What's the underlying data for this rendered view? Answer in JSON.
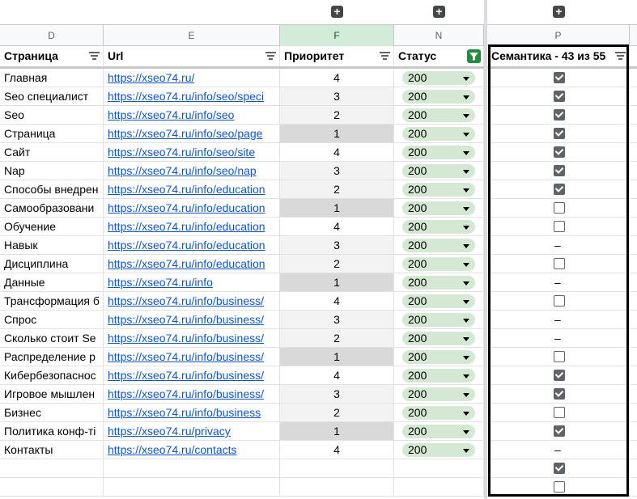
{
  "columns": {
    "D": "D",
    "E": "E",
    "F": "F",
    "N": "N",
    "P": "P"
  },
  "headers": {
    "page": "Страница",
    "url": "Url",
    "priority": "Приоритет",
    "status": "Статус",
    "semantics": "Семантика - 43 из 55"
  },
  "rows": [
    {
      "page": "Главная",
      "url": "https://xseo74.ru/",
      "priority": "4",
      "status": "200",
      "sem": "checked"
    },
    {
      "page": "Seo специалист",
      "url": "https://xseo74.ru/info/seo/speci",
      "priority": "3",
      "status": "200",
      "sem": "checked"
    },
    {
      "page": "Seo",
      "url": "https://xseo74.ru/info/seo",
      "priority": "2",
      "status": "200",
      "sem": "checked"
    },
    {
      "page": "Страница",
      "url": "https://xseo74.ru/info/seo/page",
      "priority": "1",
      "status": "200",
      "sem": "checked"
    },
    {
      "page": "Сайт",
      "url": "https://xseo74.ru/info/seo/site",
      "priority": "4",
      "status": "200",
      "sem": "checked"
    },
    {
      "page": "Nap",
      "url": "https://xseo74.ru/info/seo/nap",
      "priority": "3",
      "status": "200",
      "sem": "checked"
    },
    {
      "page": "Способы внедрен",
      "url": "https://xseo74.ru/info/education",
      "priority": "2",
      "status": "200",
      "sem": "checked"
    },
    {
      "page": "Самообразовани",
      "url": "https://xseo74.ru/info/education",
      "priority": "1",
      "status": "200",
      "sem": "unchecked"
    },
    {
      "page": "Обучение",
      "url": "https://xseo74.ru/info/education",
      "priority": "4",
      "status": "200",
      "sem": "unchecked"
    },
    {
      "page": "Навык",
      "url": "https://xseo74.ru/info/education",
      "priority": "3",
      "status": "200",
      "sem": "dash"
    },
    {
      "page": "Дисциплина",
      "url": "https://xseo74.ru/info/education",
      "priority": "2",
      "status": "200",
      "sem": "unchecked"
    },
    {
      "page": "Данные",
      "url": "https://xseo74.ru/info",
      "priority": "1",
      "status": "200",
      "sem": "dash"
    },
    {
      "page": "Трансформация б",
      "url": "https://xseo74.ru/info/business/",
      "priority": "4",
      "status": "200",
      "sem": "unchecked"
    },
    {
      "page": "Спрос",
      "url": "https://xseo74.ru/info/business/",
      "priority": "3",
      "status": "200",
      "sem": "dash"
    },
    {
      "page": "Сколько стоит Se",
      "url": "https://xseo74.ru/info/business/",
      "priority": "2",
      "status": "200",
      "sem": "dash"
    },
    {
      "page": "Распределение р",
      "url": "https://xseo74.ru/info/business/",
      "priority": "1",
      "status": "200",
      "sem": "unchecked"
    },
    {
      "page": "Кибербезопаснос",
      "url": "https://xseo74.ru/info/business/",
      "priority": "4",
      "status": "200",
      "sem": "checked"
    },
    {
      "page": "Игровое мышлен",
      "url": "https://xseo74.ru/info/business/",
      "priority": "3",
      "status": "200",
      "sem": "checked"
    },
    {
      "page": "Бизнес",
      "url": "https://xseo74.ru/info/business",
      "priority": "2",
      "status": "200",
      "sem": "unchecked"
    },
    {
      "page": "Политика конф-ті",
      "url": "https://xseo74.ru/privacy",
      "priority": "1",
      "status": "200",
      "sem": "checked"
    },
    {
      "page": "Контакты",
      "url": "https://xseo74.ru/contacts",
      "priority": "4",
      "status": "200",
      "sem": "dash"
    },
    {
      "page": "",
      "url": "",
      "priority": "",
      "status": "",
      "sem": "checked"
    },
    {
      "page": "",
      "url": "",
      "priority": "",
      "status": "",
      "sem": "unchecked"
    }
  ],
  "colors": {
    "chip": "#d4e8d3",
    "link": "#1155cc",
    "filter_active": "#1e8e3e"
  }
}
